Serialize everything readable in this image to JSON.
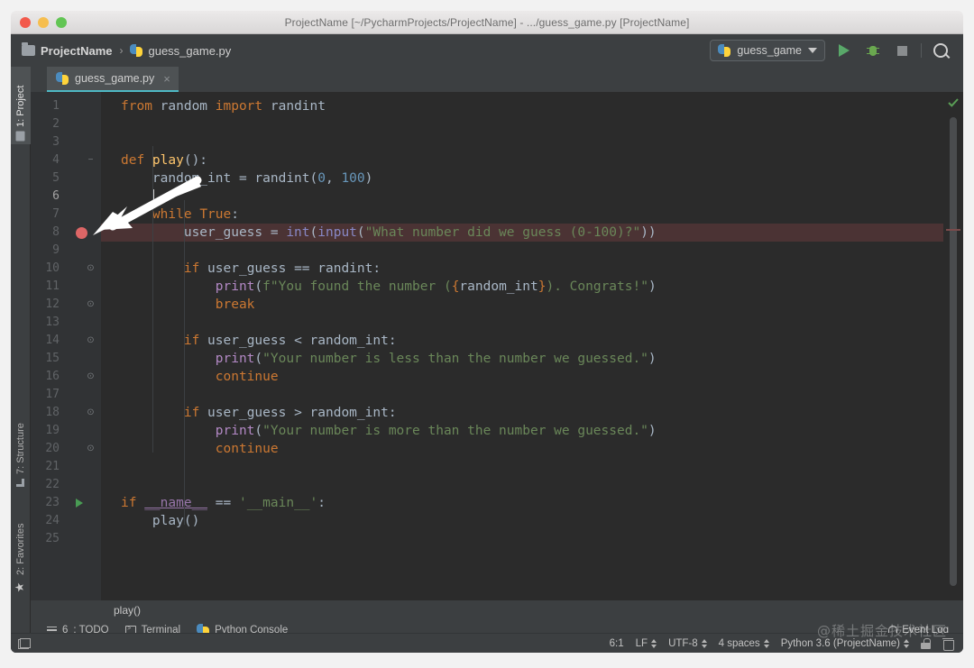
{
  "window": {
    "title": "ProjectName [~/PycharmProjects/ProjectName] - .../guess_game.py [ProjectName]",
    "traffic_lights": [
      "close",
      "minimize",
      "zoom"
    ]
  },
  "navbar": {
    "breadcrumb_project": "ProjectName",
    "breadcrumb_separator": "›",
    "breadcrumb_file": "guess_game.py",
    "run_config": "guess_game",
    "buttons": {
      "run": "Run",
      "debug": "Debug",
      "stop": "Stop",
      "search": "Search Everywhere"
    }
  },
  "left_tool_window": {
    "items": [
      {
        "label": "1: Project",
        "icon": "folder-icon",
        "active": true
      },
      {
        "label": "7: Structure",
        "icon": "structure-icon",
        "active": false
      },
      {
        "label": "2: Favorites",
        "icon": "star-icon",
        "active": false
      }
    ]
  },
  "editor": {
    "tab": {
      "label": "guess_game.py",
      "close": "×"
    },
    "breadcrumb": "play()",
    "caret_line": 6,
    "breakpoint_line": 8,
    "run_marker_line": 23,
    "inspection_status": "ok",
    "lines": [
      {
        "n": 1,
        "tokens": [
          {
            "t": "from ",
            "c": "k"
          },
          {
            "t": "random ",
            "c": ""
          },
          {
            "t": "import ",
            "c": "k"
          },
          {
            "t": "randint",
            "c": ""
          }
        ]
      },
      {
        "n": 2,
        "tokens": []
      },
      {
        "n": 3,
        "tokens": []
      },
      {
        "n": 4,
        "fold": "−",
        "tokens": [
          {
            "t": "def ",
            "c": "k"
          },
          {
            "t": "play",
            "c": "fn"
          },
          {
            "t": "():",
            "c": ""
          }
        ]
      },
      {
        "n": 5,
        "tokens": [
          {
            "t": "    random_int = randint(",
            "c": ""
          },
          {
            "t": "0",
            "c": "n"
          },
          {
            "t": ", ",
            "c": ""
          },
          {
            "t": "100",
            "c": "n"
          },
          {
            "t": ")",
            "c": ""
          }
        ]
      },
      {
        "n": 6,
        "tokens": [
          {
            "t": "    ",
            "c": ""
          }
        ]
      },
      {
        "n": 7,
        "tokens": [
          {
            "t": "    ",
            "c": ""
          },
          {
            "t": "while ",
            "c": "k"
          },
          {
            "t": "True",
            "c": "k"
          },
          {
            "t": ":",
            "c": ""
          }
        ]
      },
      {
        "n": 8,
        "hl": true,
        "tokens": [
          {
            "t": "        user_guess = ",
            "c": ""
          },
          {
            "t": "int",
            "c": "b"
          },
          {
            "t": "(",
            "c": ""
          },
          {
            "t": "input",
            "c": "b"
          },
          {
            "t": "(",
            "c": ""
          },
          {
            "t": "\"What number did we guess (0-100)?\"",
            "c": "s"
          },
          {
            "t": "))",
            "c": ""
          }
        ]
      },
      {
        "n": 9,
        "tokens": []
      },
      {
        "n": 10,
        "fold": "⊙",
        "tokens": [
          {
            "t": "        ",
            "c": ""
          },
          {
            "t": "if ",
            "c": "k"
          },
          {
            "t": "user_guess == randint:",
            "c": ""
          }
        ]
      },
      {
        "n": 11,
        "tokens": [
          {
            "t": "            ",
            "c": ""
          },
          {
            "t": "print",
            "c": "d"
          },
          {
            "t": "(",
            "c": ""
          },
          {
            "t": "f",
            "c": "s"
          },
          {
            "t": "\"You found the number (",
            "c": "s"
          },
          {
            "t": "{",
            "c": "fb"
          },
          {
            "t": "random_int",
            "c": ""
          },
          {
            "t": "}",
            "c": "fb"
          },
          {
            "t": "). Congrats!\"",
            "c": "s"
          },
          {
            "t": ")",
            "c": ""
          }
        ]
      },
      {
        "n": 12,
        "fold": "⊙",
        "tokens": [
          {
            "t": "            ",
            "c": ""
          },
          {
            "t": "break",
            "c": "k"
          }
        ]
      },
      {
        "n": 13,
        "tokens": []
      },
      {
        "n": 14,
        "fold": "⊙",
        "tokens": [
          {
            "t": "        ",
            "c": ""
          },
          {
            "t": "if ",
            "c": "k"
          },
          {
            "t": "user_guess < random_int:",
            "c": ""
          }
        ]
      },
      {
        "n": 15,
        "tokens": [
          {
            "t": "            ",
            "c": ""
          },
          {
            "t": "print",
            "c": "d"
          },
          {
            "t": "(",
            "c": ""
          },
          {
            "t": "\"Your number is less than the number we guessed.\"",
            "c": "s"
          },
          {
            "t": ")",
            "c": ""
          }
        ]
      },
      {
        "n": 16,
        "fold": "⊙",
        "tokens": [
          {
            "t": "            ",
            "c": ""
          },
          {
            "t": "continue",
            "c": "k"
          }
        ]
      },
      {
        "n": 17,
        "tokens": []
      },
      {
        "n": 18,
        "fold": "⊙",
        "tokens": [
          {
            "t": "        ",
            "c": ""
          },
          {
            "t": "if ",
            "c": "k"
          },
          {
            "t": "user_guess > random_int:",
            "c": ""
          }
        ]
      },
      {
        "n": 19,
        "tokens": [
          {
            "t": "            ",
            "c": ""
          },
          {
            "t": "print",
            "c": "d"
          },
          {
            "t": "(",
            "c": ""
          },
          {
            "t": "\"Your number is more than the number we guessed.\"",
            "c": "s"
          },
          {
            "t": ")",
            "c": ""
          }
        ]
      },
      {
        "n": 20,
        "fold": "⊙",
        "tokens": [
          {
            "t": "            ",
            "c": ""
          },
          {
            "t": "continue",
            "c": "k"
          }
        ]
      },
      {
        "n": 21,
        "tokens": []
      },
      {
        "n": 22,
        "tokens": []
      },
      {
        "n": 23,
        "tokens": [
          {
            "t": "if ",
            "c": "k"
          },
          {
            "t": "__name__",
            "c": "u"
          },
          {
            "t": " == ",
            "c": ""
          },
          {
            "t": "'__main__'",
            "c": "s"
          },
          {
            "t": ":",
            "c": ""
          }
        ]
      },
      {
        "n": 24,
        "tokens": [
          {
            "t": "    play()",
            "c": ""
          }
        ]
      },
      {
        "n": 25,
        "tokens": []
      }
    ]
  },
  "bottom_tool_bar": {
    "items": [
      {
        "label_prefix": "6",
        "label": ": TODO",
        "icon": "list-icon"
      },
      {
        "label_prefix": "",
        "label": "Terminal",
        "icon": "terminal-icon"
      },
      {
        "label_prefix": "",
        "label": "Python Console",
        "icon": "python-icon"
      }
    ],
    "event_log": "Event Log"
  },
  "status_bar": {
    "caret_position": "6:1",
    "line_separator": "LF",
    "encoding": "UTF-8",
    "indent": "4 spaces",
    "interpreter": "Python 3.6 (ProjectName)",
    "icons": [
      "lock-icon",
      "trash-icon"
    ]
  },
  "annotation": {
    "type": "arrow",
    "points_to": "breakpoint"
  },
  "watermark": "@稀土掘金技术社区",
  "colors": {
    "editor_bg": "#2b2b2b",
    "gutter_bg": "#313335",
    "chrome_bg": "#3c3f41",
    "tab_active_underline": "#4eb8c4",
    "keyword": "#cc7832",
    "string": "#6a8759",
    "number": "#6897bb",
    "function": "#ffc66d",
    "breakpoint": "#dd6666",
    "breakpoint_line_bg": "#4b3334",
    "run_green": "#59a869"
  }
}
